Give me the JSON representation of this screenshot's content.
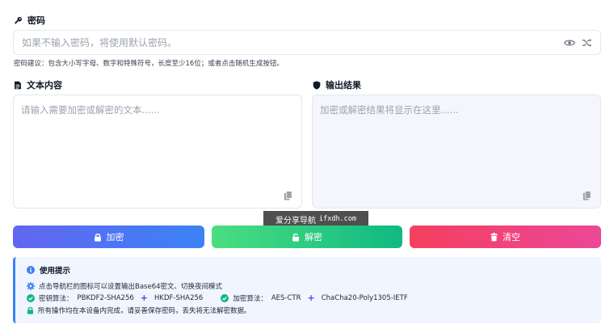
{
  "password": {
    "label": "密码",
    "placeholder": "如果不输入密码，将使用默认密码。",
    "hint": "密码建议：包含大小写字母、数字和特殊符号，长度至少16位；或者点击随机生成按钮。",
    "icons": [
      "key-icon",
      "eye-icon",
      "shuffle-icon"
    ]
  },
  "input_text": {
    "label": "文本内容",
    "placeholder": "请输入需要加密或解密的文本......"
  },
  "output": {
    "label": "输出结果",
    "placeholder": "加密或解密结果将显示在这里......"
  },
  "buttons": {
    "encrypt": "加密",
    "decrypt": "解密",
    "clear": "清空"
  },
  "watermark": {
    "name": "爱分享导航",
    "domain": "ifxdh.com"
  },
  "tips": {
    "title": "使用提示",
    "line1": "点击导航栏的图标可以设置输出Base64密文、切换夜间模式",
    "kdf_label": "密钥算法：",
    "kdf_a": "PBKDF2-SHA256",
    "kdf_b": "HKDF-SHA256",
    "enc_label": "加密算法：",
    "enc_a": "AES-CTR",
    "enc_b": "ChaCha20-Poly1305-IETF",
    "line3": "所有操作均在本设备内完成，请妥善保存密码，丢失将无法解密数据。"
  },
  "colors": {
    "encrypt": "#6366f1",
    "decrypt": "#10b981",
    "clear": "#f43f5e",
    "tips_bg": "#f0f5ff",
    "accent": "#3b82f6",
    "check": "#10b981"
  }
}
